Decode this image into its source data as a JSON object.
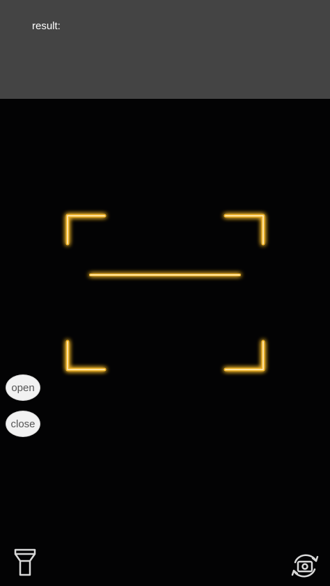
{
  "result": {
    "label": "result:"
  },
  "controls": {
    "open_label": "open",
    "close_label": "close"
  },
  "icons": {
    "torch": "flashlight-icon",
    "switch_camera": "switch-camera-icon"
  },
  "colors": {
    "result_panel": "#444444",
    "camera_bg": "#030304",
    "scan_accent": "#f0b429",
    "scan_core": "#fff1c6"
  }
}
